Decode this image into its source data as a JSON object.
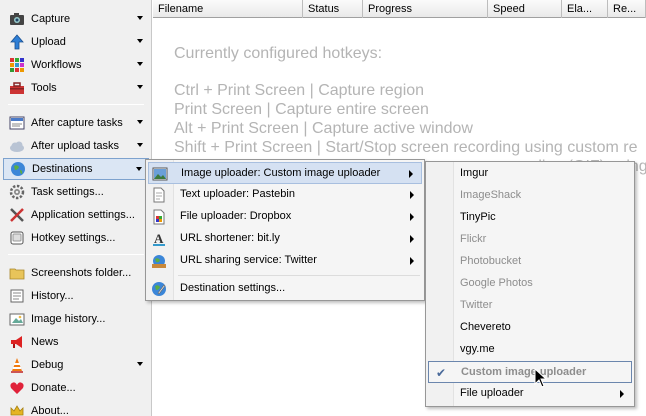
{
  "sidebar": {
    "items": [
      {
        "label": "Capture",
        "icon": "camera-icon",
        "arrow": true
      },
      {
        "label": "Upload",
        "icon": "upload-arrow-icon",
        "arrow": true
      },
      {
        "label": "Workflows",
        "icon": "workflows-grid-icon",
        "arrow": true
      },
      {
        "label": "Tools",
        "icon": "toolbox-icon",
        "arrow": true
      },
      {
        "label": "After capture tasks",
        "icon": "after-capture-icon",
        "arrow": true
      },
      {
        "label": "After upload tasks",
        "icon": "cloud-upload-icon",
        "arrow": true
      },
      {
        "label": "Destinations",
        "icon": "globe-icon",
        "arrow": true
      },
      {
        "label": "Task settings...",
        "icon": "gear-icon",
        "arrow": false
      },
      {
        "label": "Application settings...",
        "icon": "wrench-screwdriver-icon",
        "arrow": false
      },
      {
        "label": "Hotkey settings...",
        "icon": "keyboard-icon",
        "arrow": false
      },
      {
        "label": "Screenshots folder...",
        "icon": "folder-icon",
        "arrow": false
      },
      {
        "label": "History...",
        "icon": "history-icon",
        "arrow": false
      },
      {
        "label": "Image history...",
        "icon": "image-history-icon",
        "arrow": false
      },
      {
        "label": "News",
        "icon": "megaphone-icon",
        "arrow": false
      },
      {
        "label": "Debug",
        "icon": "debug-cone-icon",
        "arrow": true
      },
      {
        "label": "Donate...",
        "icon": "heart-icon",
        "arrow": false
      },
      {
        "label": "About...",
        "icon": "crown-icon",
        "arrow": false
      }
    ]
  },
  "columns": [
    "Filename",
    "Status",
    "Progress",
    "Speed",
    "Ela...",
    "Re..."
  ],
  "hotkeys": {
    "title": "Currently configured hotkeys:",
    "lines": [
      "Ctrl + Print Screen  |  Capture region",
      "Print Screen  |  Capture entire screen",
      "Alt + Print Screen  |  Capture active window",
      "Shift + Print Screen  |  Start/Stop screen recording using custom re",
      "Ctrl + Shift + Print Screen  |  Start/Stop screen recording (GIF) using"
    ]
  },
  "destinations_menu": {
    "items": [
      {
        "label": "Image uploader: Custom image uploader",
        "icon": "image-uploader-icon",
        "submenu": true
      },
      {
        "label": "Text uploader: Pastebin",
        "icon": "text-document-icon",
        "submenu": true
      },
      {
        "label": "File uploader: Dropbox",
        "icon": "file-uploader-icon",
        "submenu": true
      },
      {
        "label": "URL shortener: bit.ly",
        "icon": "url-shortener-icon",
        "submenu": true
      },
      {
        "label": "URL sharing service: Twitter",
        "icon": "url-sharing-icon",
        "submenu": true
      },
      {
        "label": "Destination settings...",
        "icon": "destination-settings-icon",
        "submenu": false
      }
    ]
  },
  "image_uploader_menu": {
    "items": [
      {
        "label": "Imgur",
        "enabled": true
      },
      {
        "label": "ImageShack",
        "enabled": false
      },
      {
        "label": "TinyPic",
        "enabled": true
      },
      {
        "label": "Flickr",
        "enabled": false
      },
      {
        "label": "Photobucket",
        "enabled": false
      },
      {
        "label": "Google Photos",
        "enabled": false
      },
      {
        "label": "Twitter",
        "enabled": false
      },
      {
        "label": "Chevereto",
        "enabled": true
      },
      {
        "label": "vgy.me",
        "enabled": true
      },
      {
        "label": "Custom image uploader",
        "enabled": false,
        "checked": true
      },
      {
        "label": "File uploader",
        "enabled": true,
        "submenu": true
      }
    ],
    "check_glyph": "✔"
  }
}
